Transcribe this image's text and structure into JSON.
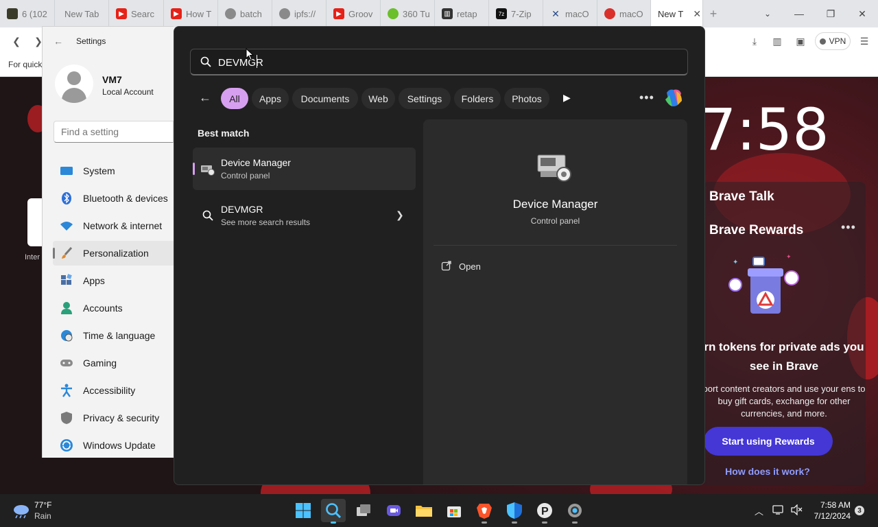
{
  "browser": {
    "tabs": [
      {
        "label": "6 (102",
        "favicon": "game-thumb-icon",
        "color": "#3b3b2a"
      },
      {
        "label": "New Tab",
        "favicon": "none",
        "color": "#e3e5e8"
      },
      {
        "label": "Searc",
        "favicon": "youtube-icon",
        "color": "#e62117"
      },
      {
        "label": "How T",
        "favicon": "youtube-icon",
        "color": "#e62117"
      },
      {
        "label": "batch",
        "favicon": "globe-icon",
        "color": "#8a8a8a"
      },
      {
        "label": "ipfs://",
        "favicon": "globe-icon",
        "color": "#8a8a8a"
      },
      {
        "label": "Groov",
        "favicon": "youtube-icon",
        "color": "#e62117"
      },
      {
        "label": "360 Tu",
        "favicon": "360-icon",
        "color": "#6abf2a"
      },
      {
        "label": "retap",
        "favicon": "building-icon",
        "color": "#333333"
      },
      {
        "label": "7-Zip",
        "favicon": "7zip-icon",
        "color": "#111111"
      },
      {
        "label": "macO",
        "favicon": "x-logo-icon",
        "color": "#2a4a8a"
      },
      {
        "label": "macO",
        "favicon": "macos-icon",
        "color": "#d9302c"
      },
      {
        "label": "New T",
        "favicon": "none",
        "color": "#ffffff",
        "active": true
      }
    ],
    "bookmarks_bar_text": "For quick",
    "vpn_label": "VPN"
  },
  "settings": {
    "title": "Settings",
    "user_name": "VM7",
    "user_type": "Local Account",
    "search_placeholder": "Find a setting",
    "nav": [
      {
        "label": "System",
        "icon": "monitor-icon"
      },
      {
        "label": "Bluetooth & devices",
        "icon": "bluetooth-icon"
      },
      {
        "label": "Network & internet",
        "icon": "wifi-icon"
      },
      {
        "label": "Personalization",
        "icon": "brush-icon",
        "selected": true
      },
      {
        "label": "Apps",
        "icon": "apps-icon"
      },
      {
        "label": "Accounts",
        "icon": "person-icon"
      },
      {
        "label": "Time & language",
        "icon": "globe-clock-icon"
      },
      {
        "label": "Gaming",
        "icon": "gamepad-icon"
      },
      {
        "label": "Accessibility",
        "icon": "accessibility-icon"
      },
      {
        "label": "Privacy & security",
        "icon": "shield-icon"
      },
      {
        "label": "Windows Update",
        "icon": "update-icon"
      }
    ]
  },
  "search": {
    "query": "DEVMGR",
    "filters": [
      "All",
      "Apps",
      "Documents",
      "Web",
      "Settings",
      "Folders",
      "Photos"
    ],
    "active_filter": "All",
    "accent": "#d79ff0",
    "best_match_label": "Best match",
    "results": [
      {
        "title": "Device Manager",
        "subtitle": "Control panel",
        "icon": "device-manager-icon"
      },
      {
        "title": "DEVMGR",
        "subtitle": "See more search results",
        "icon": "search-icon"
      }
    ],
    "preview": {
      "title": "Device Manager",
      "subtitle": "Control panel",
      "actions": [
        {
          "label": "Open",
          "icon": "open-external-icon"
        }
      ]
    }
  },
  "newtab": {
    "clock": "7:58",
    "brave_talk": "Brave Talk",
    "rewards_title": "Brave Rewards",
    "rewards_heading": "rn tokens for private ads you see in Brave",
    "rewards_body": "port content creators and use your ens to buy gift cards, exchange for other currencies, and more.",
    "rewards_cta": "Start using Rewards",
    "rewards_link": "How does it work?",
    "tile_label": "Inter"
  },
  "taskbar": {
    "weather_temp": "77°F",
    "weather_condition": "Rain",
    "time": "7:58 AM",
    "date": "7/12/2024",
    "notification_count": "3"
  }
}
